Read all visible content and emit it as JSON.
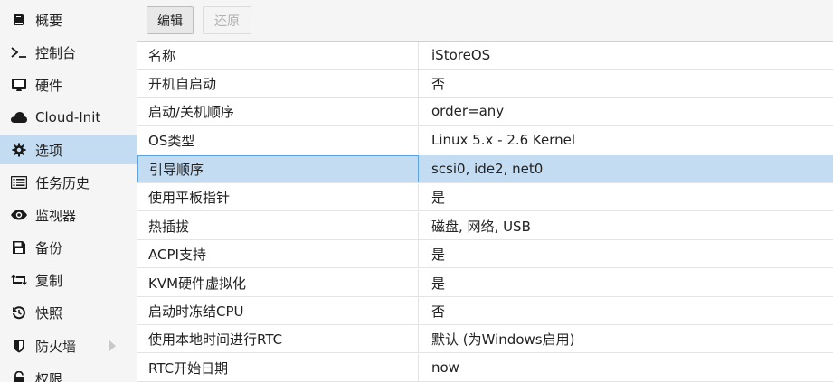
{
  "sidebar": {
    "items": [
      {
        "label": "概要",
        "icon": "book-icon",
        "selected": false
      },
      {
        "label": "控制台",
        "icon": "terminal-icon",
        "selected": false
      },
      {
        "label": "硬件",
        "icon": "desktop-icon",
        "selected": false
      },
      {
        "label": "Cloud-Init",
        "icon": "cloud-icon",
        "selected": false
      },
      {
        "label": "选项",
        "icon": "gear-icon",
        "selected": true
      },
      {
        "label": "任务历史",
        "icon": "list-icon",
        "selected": false
      },
      {
        "label": "监视器",
        "icon": "eye-icon",
        "selected": false
      },
      {
        "label": "备份",
        "icon": "floppy-icon",
        "selected": false
      },
      {
        "label": "复制",
        "icon": "retweet-icon",
        "selected": false
      },
      {
        "label": "快照",
        "icon": "history-icon",
        "selected": false
      },
      {
        "label": "防火墙",
        "icon": "shield-icon",
        "selected": false
      },
      {
        "label": "权限",
        "icon": "unlock-icon",
        "selected": false
      }
    ]
  },
  "toolbar": {
    "edit_label": "编辑",
    "revert_label": "还原"
  },
  "options": {
    "rows": [
      {
        "key": "名称",
        "value": "iStoreOS"
      },
      {
        "key": "开机自启动",
        "value": "否"
      },
      {
        "key": "启动/关机顺序",
        "value": "order=any"
      },
      {
        "key": "OS类型",
        "value": "Linux 5.x - 2.6 Kernel"
      },
      {
        "key": "引导顺序",
        "value": "scsi0, ide2, net0",
        "selected": true
      },
      {
        "key": "使用平板指针",
        "value": "是"
      },
      {
        "key": "热插拔",
        "value": "磁盘, 网络, USB"
      },
      {
        "key": "ACPI支持",
        "value": "是"
      },
      {
        "key": "KVM硬件虚拟化",
        "value": "是"
      },
      {
        "key": "启动时冻结CPU",
        "value": "否"
      },
      {
        "key": "使用本地时间进行RTC",
        "value": "默认 (为Windows启用)"
      },
      {
        "key": "RTC开始日期",
        "value": "now"
      }
    ]
  },
  "colors": {
    "selection": "#c3dcf2",
    "selection_border": "#5fa2dd",
    "sidebar_bg": "#f5f5f5"
  }
}
